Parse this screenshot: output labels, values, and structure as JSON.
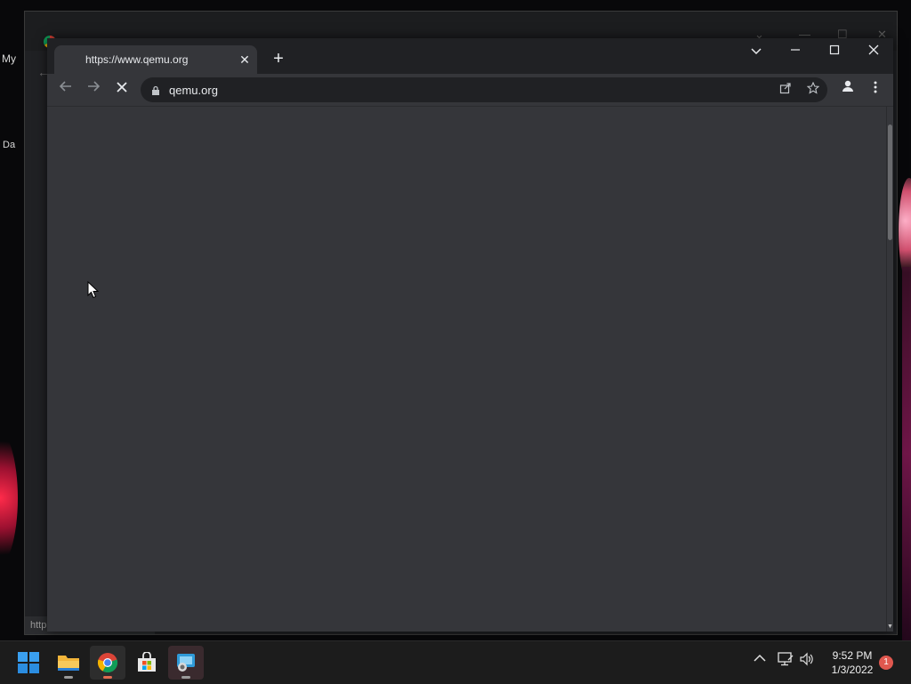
{
  "desktop": {
    "labels": [
      "My",
      "Da"
    ]
  },
  "background_window": {
    "status_text": "http"
  },
  "browser": {
    "tab": {
      "title": "https://www.qemu.org",
      "close_glyph": "✕"
    },
    "new_tab_glyph": "+",
    "window_controls": {
      "tab_search_glyph": "⌄",
      "minimize_glyph": "—",
      "maximize_glyph": "☐",
      "close_glyph": "✕"
    },
    "toolbar": {
      "back_glyph": "←",
      "forward_glyph": "→",
      "stop_glyph": "✕"
    },
    "address_bar": {
      "url": "qemu.org"
    },
    "icons": [
      "back-icon",
      "forward-icon",
      "stop-loading-icon",
      "lock-icon",
      "share-icon",
      "star-icon",
      "profile-icon",
      "menu-icon"
    ]
  },
  "taskbar": {
    "apps": [
      "start-icon",
      "file-explorer-icon",
      "chrome-icon",
      "microsoft-store-icon",
      "app-icon"
    ],
    "clock": {
      "time": "9:52 PM",
      "date": "1/3/2022"
    },
    "notification_count": "1",
    "tray": {
      "chevron_glyph": "^",
      "sound_glyph": "🔈"
    }
  },
  "colors": {
    "window_bg": "#202124",
    "toolbar_bg": "#35363a",
    "content_bg": "#35363a",
    "taskbar_bg": "#1c1c1c"
  }
}
